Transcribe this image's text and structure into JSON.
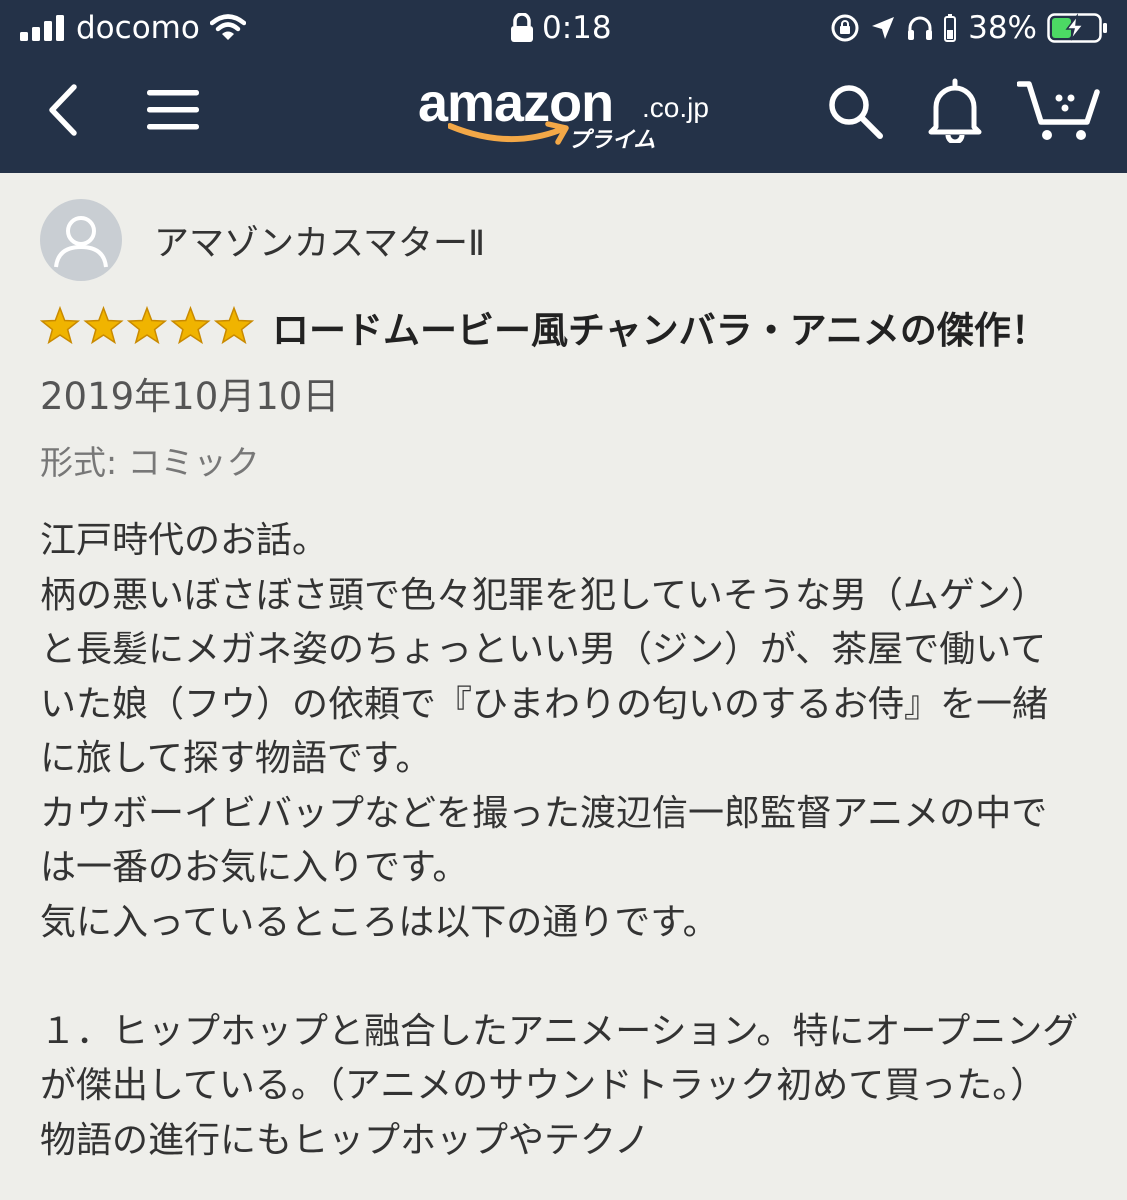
{
  "status_bar": {
    "carrier": "docomo",
    "time": "0:18",
    "battery": "38%"
  },
  "nav": {
    "logo_main": "amazon",
    "logo_tld": ".co.jp",
    "logo_sub": "プライム",
    "icons": [
      "back-icon",
      "menu-icon",
      "search-icon",
      "bell-icon",
      "cart-icon"
    ]
  },
  "review": {
    "reviewer": "アマゾンカスマターⅡ",
    "rating": 5,
    "title": "ロードムービー風チャンバラ・アニメの傑作！",
    "date": "2019年10月10日",
    "format": "形式: コミック",
    "body": [
      "江戸時代のお話。",
      "柄の悪いぼさぼさ頭で色々犯罪を犯していそうな男（ムゲン）と長髪にメガネ姿のちょっといい男（ジン）が、茶屋で働いていた娘（フウ）の依頼で『ひまわりの匂いのするお侍』を一緒に旅して探す物語です。",
      "カウボーイビバップなどを撮った渡辺信一郎監督アニメの中では一番のお気に入りです。",
      "気に入っているところは以下の通りです。",
      "",
      "１．ヒップホップと融合したアニメーション。特にオープニングが傑出している。（アニメのサウンドトラック初めて買った。）物語の進行にもヒップホップやテクノ"
    ]
  },
  "colors": {
    "header_bg": "#243248",
    "page_bg": "#eeeeea",
    "star": "#f0b400",
    "smile": "#f3a847"
  }
}
